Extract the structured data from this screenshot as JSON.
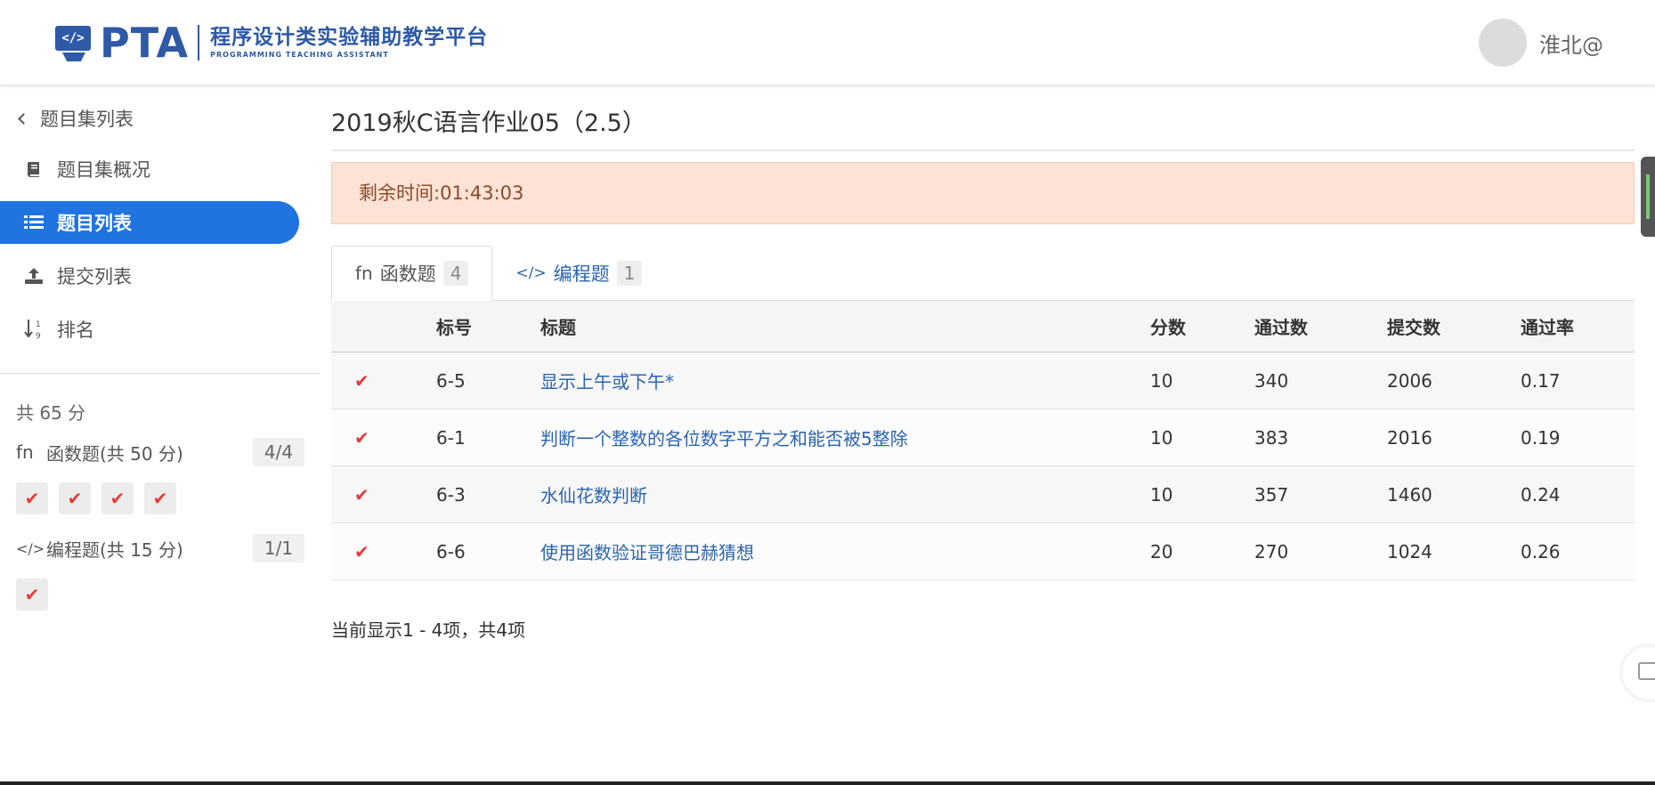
{
  "header": {
    "logo_mark": "</>",
    "logo_text": "PTA",
    "logo_cn": "程序设计类实验辅助教学平台",
    "logo_en": "PROGRAMMING TEACHING ASSISTANT",
    "username": "淮北@"
  },
  "sidebar": {
    "back_label": "题目集列表",
    "items": [
      {
        "label": "题目集概况",
        "icon": "book-icon"
      },
      {
        "label": "题目列表",
        "icon": "list-icon"
      },
      {
        "label": "提交列表",
        "icon": "upload-icon"
      },
      {
        "label": "排名",
        "icon": "sort-numeric-icon"
      }
    ],
    "total": "共 65 分",
    "categories": [
      {
        "icon_text": "fn",
        "label": "函数题(共 50 分)",
        "count": "4/4"
      },
      {
        "icon_text": "</>",
        "label": "编程题(共 15 分)",
        "count": "1/1"
      }
    ],
    "check_glyph": "✔"
  },
  "main": {
    "title": "2019秋C语言作业05（2.5）",
    "timer": "剩余时间:01:43:03",
    "tabs": [
      {
        "icon_text": "fn",
        "label": "函数题",
        "count": "4"
      },
      {
        "icon_text": "</>",
        "label": "编程题",
        "count": "1"
      }
    ],
    "table": {
      "headers": [
        "",
        "标号",
        "标题",
        "分数",
        "通过数",
        "提交数",
        "通过率"
      ],
      "rows": [
        {
          "status": "✔",
          "id": "6-5",
          "title": "显示上午或下午*",
          "score": "10",
          "passed": "340",
          "submitted": "2006",
          "rate": "0.17"
        },
        {
          "status": "✔",
          "id": "6-1",
          "title": "判断一个整数的各位数字平方之和能否被5整除",
          "score": "10",
          "passed": "383",
          "submitted": "2016",
          "rate": "0.19"
        },
        {
          "status": "✔",
          "id": "6-3",
          "title": "水仙花数判断",
          "score": "10",
          "passed": "357",
          "submitted": "1460",
          "rate": "0.24"
        },
        {
          "status": "✔",
          "id": "6-6",
          "title": "使用函数验证哥德巴赫猜想",
          "score": "20",
          "passed": "270",
          "submitted": "1024",
          "rate": "0.26"
        }
      ]
    },
    "summary": "当前显示1 - 4项，共4项"
  },
  "colors": {
    "brand": "#2e5aa6",
    "active_nav": "#1f74e0",
    "check": "#e33b3b",
    "timer_bg": "#fde2d6",
    "link": "#2a64b0"
  }
}
